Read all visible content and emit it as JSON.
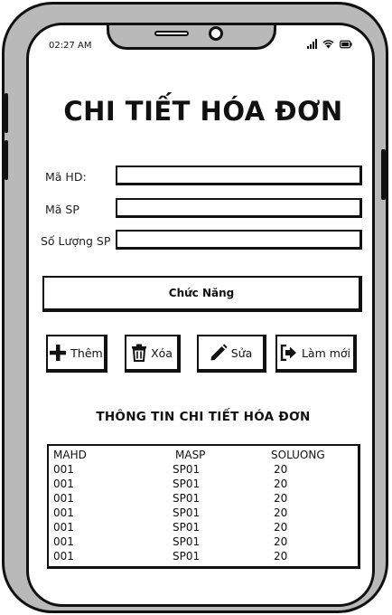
{
  "status": {
    "time": "02:27 AM"
  },
  "title": "CHI TIẾT HÓA ĐƠN",
  "form": {
    "fields": [
      {
        "label": "Mã HD:",
        "value": ""
      },
      {
        "label": "Mã SP",
        "value": ""
      },
      {
        "label": "Số Lượng SP",
        "value": ""
      }
    ]
  },
  "function_label": "Chức Năng",
  "actions": [
    {
      "label": "Thêm",
      "icon": "plus-icon"
    },
    {
      "label": "Xóa",
      "icon": "trash-icon"
    },
    {
      "label": "Sửa",
      "icon": "pencil-icon"
    },
    {
      "label": "Làm mới",
      "icon": "sign-in-icon"
    }
  ],
  "section_title": "THÔNG TIN CHI TIẾT HÓA ĐƠN",
  "table": {
    "columns": [
      "MAHD",
      "MASP",
      "SOLUONG"
    ],
    "rows": [
      [
        "001",
        "SP01",
        "20"
      ],
      [
        "001",
        "SP01",
        "20"
      ],
      [
        "001",
        "SP01",
        "20"
      ],
      [
        "001",
        "SP01",
        "20"
      ],
      [
        "001",
        "SP01",
        "20"
      ],
      [
        "001",
        "SP01",
        "20"
      ],
      [
        "001",
        "SP01",
        "20"
      ]
    ]
  }
}
